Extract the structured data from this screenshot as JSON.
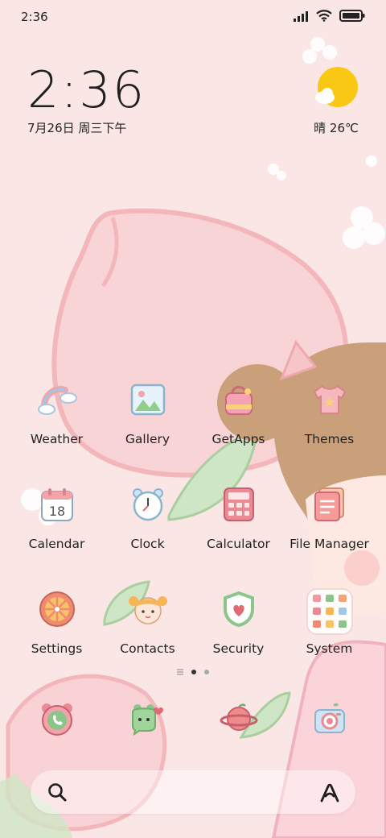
{
  "status": {
    "time": "2:36"
  },
  "clock": {
    "time": "2:36",
    "date": "7月26日 周三下午"
  },
  "weather": {
    "text": "晴 26℃",
    "icon": "sunny-cloud-icon"
  },
  "apps": [
    {
      "label": "Weather",
      "icon": "weather-icon"
    },
    {
      "label": "Gallery",
      "icon": "gallery-icon"
    },
    {
      "label": "GetApps",
      "icon": "getapps-icon"
    },
    {
      "label": "Themes",
      "icon": "themes-icon"
    },
    {
      "label": "Calendar",
      "icon": "calendar-icon",
      "day": "18"
    },
    {
      "label": "Clock",
      "icon": "clock-icon"
    },
    {
      "label": "Calculator",
      "icon": "calculator-icon"
    },
    {
      "label": "File Manager",
      "icon": "file-manager-icon"
    },
    {
      "label": "Settings",
      "icon": "settings-icon"
    },
    {
      "label": "Contacts",
      "icon": "contacts-icon"
    },
    {
      "label": "Security",
      "icon": "security-icon"
    },
    {
      "label": "System",
      "icon": "system-folder-icon"
    }
  ],
  "dock": [
    {
      "icon": "phone-icon"
    },
    {
      "icon": "messages-icon"
    },
    {
      "icon": "browser-icon"
    },
    {
      "icon": "camera-icon"
    }
  ],
  "pager": {
    "pages": 2,
    "current": 1
  },
  "colors": {
    "background": "#fbe6e6",
    "peach": "#f6b9bd",
    "leaf": "#bfe0b6",
    "hair": "#c9a07a"
  }
}
